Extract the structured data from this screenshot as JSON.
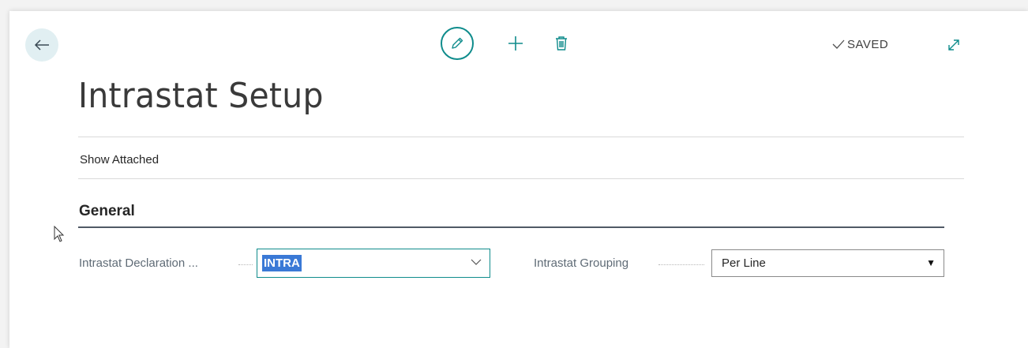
{
  "header": {
    "saved_label": "SAVED",
    "icons": {
      "back": "arrow-left-icon",
      "edit": "pencil-icon",
      "new": "plus-icon",
      "delete": "trash-icon",
      "saved": "check-icon",
      "expand": "expand-icon"
    }
  },
  "page": {
    "title": "Intrastat Setup",
    "actions": [
      "Show Attached"
    ]
  },
  "section": {
    "title": "General",
    "fields": [
      {
        "label": "Intrastat Declaration ...",
        "value": "INTRA",
        "type": "combo"
      },
      {
        "label": "Intrastat Grouping",
        "value": "Per Line",
        "type": "select"
      }
    ]
  },
  "colors": {
    "accent": "#0f8c8c",
    "selection": "#3a79d6",
    "back_button_bg": "#e1eff2",
    "section_rule": "#505a66"
  }
}
